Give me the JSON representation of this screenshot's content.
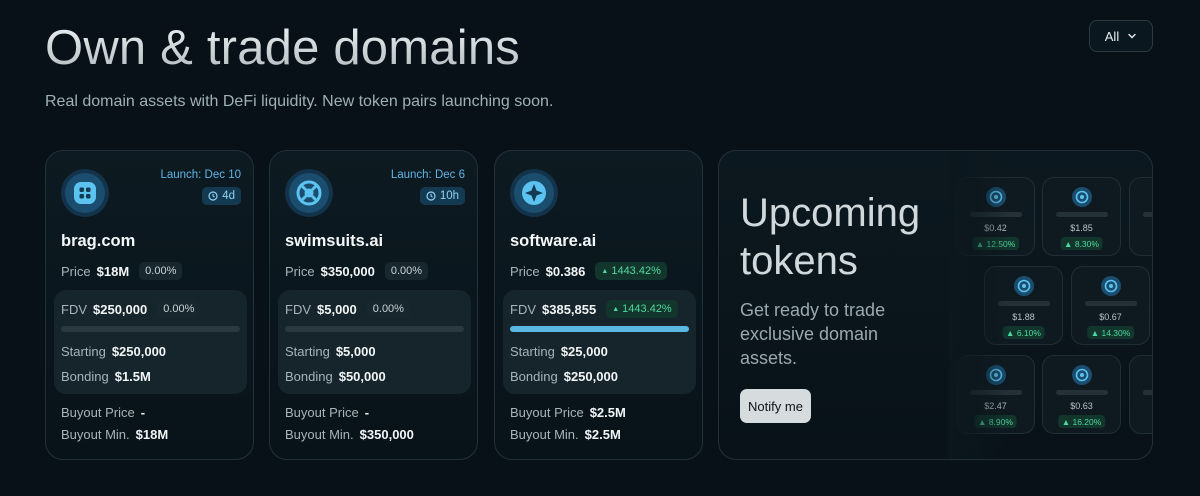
{
  "header": {
    "title": "Own & trade domains",
    "subtitle": "Real domain assets with DeFi liquidity. New token pairs launching soon.",
    "filter_label": "All"
  },
  "cards": [
    {
      "launch": "Launch: Dec 10",
      "timer": "4d",
      "name": "brag.com",
      "price_label": "Price",
      "price": "$18M",
      "price_change": "0.00%",
      "price_change_up": false,
      "fdv_label": "FDV",
      "fdv": "$250,000",
      "fdv_change": "0.00%",
      "fdv_change_up": false,
      "bonding_progress": 0,
      "starting_label": "Starting",
      "starting": "$250,000",
      "bonding_label": "Bonding",
      "bonding": "$1.5M",
      "buyout_price_label": "Buyout Price",
      "buyout_price": "-",
      "buyout_min_label": "Buyout Min.",
      "buyout_min": "$18M",
      "icon": "brag-logo-icon"
    },
    {
      "launch": "Launch: Dec 6",
      "timer": "10h",
      "name": "swimsuits.ai",
      "price_label": "Price",
      "price": "$350,000",
      "price_change": "0.00%",
      "price_change_up": false,
      "fdv_label": "FDV",
      "fdv": "$5,000",
      "fdv_change": "0.00%",
      "fdv_change_up": false,
      "bonding_progress": 0,
      "starting_label": "Starting",
      "starting": "$5,000",
      "bonding_label": "Bonding",
      "bonding": "$50,000",
      "buyout_price_label": "Buyout Price",
      "buyout_price": "-",
      "buyout_min_label": "Buyout Min.",
      "buyout_min": "$350,000",
      "icon": "swimsuits-logo-icon"
    },
    {
      "launch": "",
      "timer": "",
      "name": "software.ai",
      "price_label": "Price",
      "price": "$0.386",
      "price_change": "1443.42%",
      "price_change_up": true,
      "fdv_label": "FDV",
      "fdv": "$385,855",
      "fdv_change": "1443.42%",
      "fdv_change_up": true,
      "bonding_progress": 1,
      "starting_label": "Starting",
      "starting": "$25,000",
      "bonding_label": "Bonding",
      "bonding": "$250,000",
      "buyout_price_label": "Buyout Price",
      "buyout_price": "$2.5M",
      "buyout_min_label": "Buyout Min.",
      "buyout_min": "$2.5M",
      "icon": "software-logo-icon"
    }
  ],
  "upcoming": {
    "title": "Upcoming tokens",
    "subtitle": "Get ready to trade exclusive domain assets.",
    "notify_label": "Notify me",
    "tokens": [
      {
        "price": "$0.42",
        "change": "▲ 12.50%"
      },
      {
        "price": "$1.85",
        "change": "▲ 8.30%"
      },
      {
        "price": "",
        "change": "▲"
      },
      {
        "price": "$1.88",
        "change": "▲ 6.10%"
      },
      {
        "price": "$0.67",
        "change": "▲ 14.30%"
      },
      {
        "price": "$2.47",
        "change": "▲ 8.90%"
      },
      {
        "price": "$0.63",
        "change": "▲ 16.20%"
      },
      {
        "price": "",
        "change": "▲"
      }
    ]
  },
  "colors": {
    "accent": "#5bb8e3",
    "positive": "#4fd9a0",
    "background": "#071117"
  }
}
